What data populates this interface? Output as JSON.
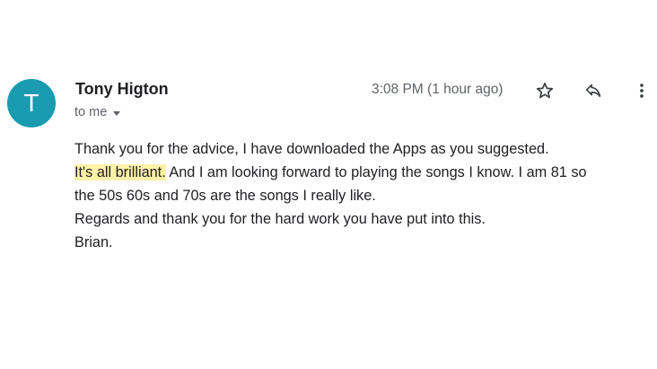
{
  "email": {
    "sender": {
      "avatar_letter": "T",
      "avatar_color": "#1a9bb0",
      "name": "Tony Higton"
    },
    "recipient": {
      "label": "to me",
      "dropdown_icon": "caret-down-icon"
    },
    "timestamp": "3:08 PM (1 hour ago)",
    "actions": {
      "star_icon": "star-icon",
      "reply_icon": "reply-icon",
      "more_icon": "more-vertical-icon"
    },
    "body": {
      "line1": "Thank you for the advice, I have downloaded the Apps as you suggested.",
      "highlighted_text": "It's all brilliant.",
      "line2_rest": " And I am looking forward to playing the songs I know.  I am 81 so",
      "line3": "the 50s 60s and 70s are the songs I really like.",
      "line4": "Regards and thank you for the hard work you have put into this.",
      "line5": "Brian."
    },
    "colors": {
      "highlight": "#fff2a8",
      "text": "#202124",
      "muted": "#5f6368"
    }
  }
}
